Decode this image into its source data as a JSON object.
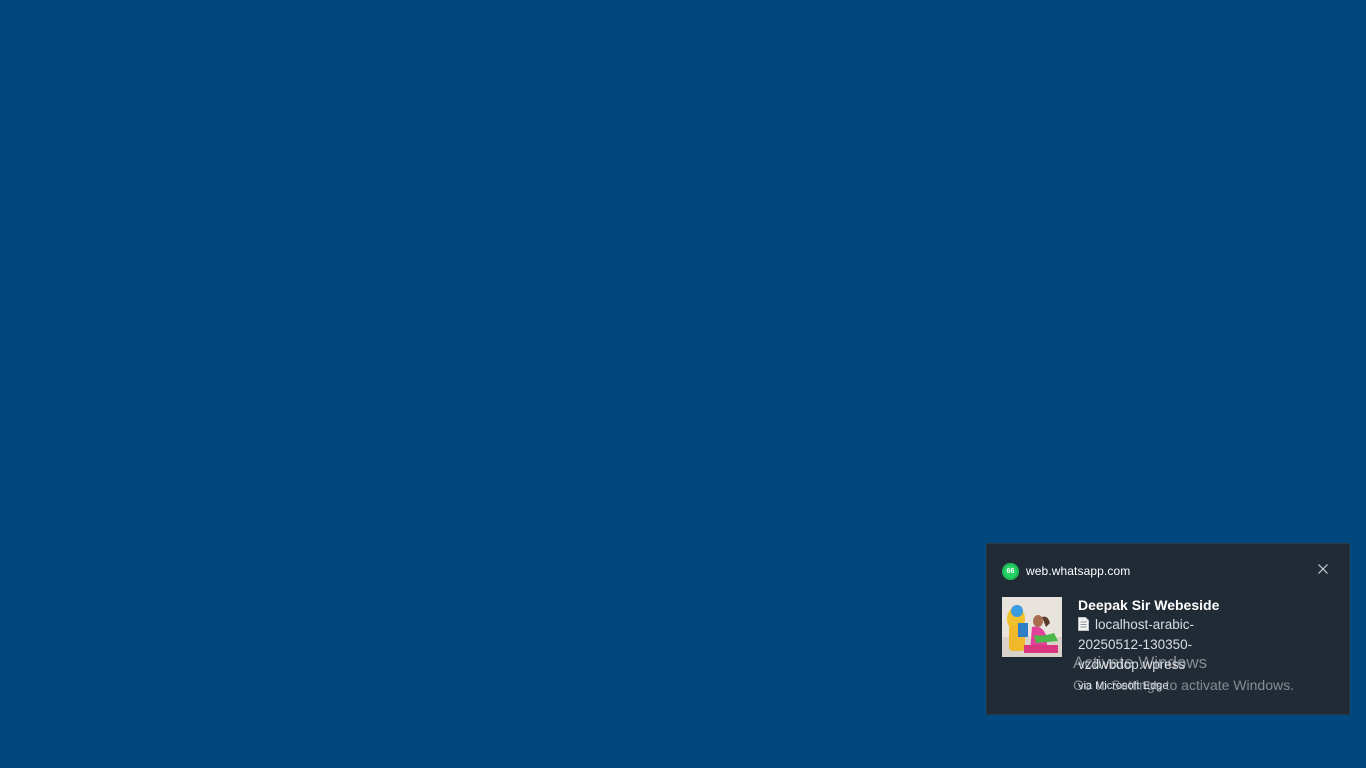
{
  "notification": {
    "app_name": "web.whatsapp.com",
    "app_badge": "66",
    "sender": "Deepak Sir Webeside",
    "message": "localhost-arabic-20250512-130350-vzdwbdop.wpress",
    "via": "via Microsoft Edge",
    "app_icon": "whatsapp-icon",
    "close_icon": "close-icon",
    "attachment_icon": "document-icon"
  },
  "watermark": {
    "title": "Activate Windows",
    "subtitle": "Go to Settings to activate Windows."
  },
  "colors": {
    "desktop_background": "#01487f",
    "toast_background": "#212b36",
    "whatsapp_green": "#25d366"
  }
}
